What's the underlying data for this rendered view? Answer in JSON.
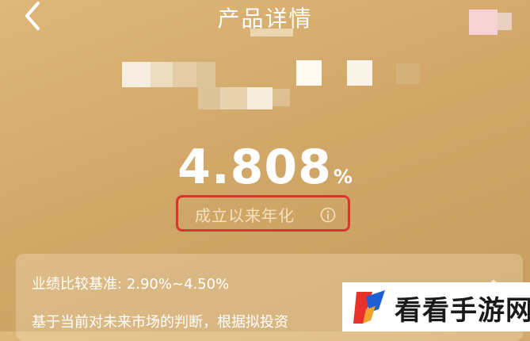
{
  "header": {
    "title": "产品详情"
  },
  "rate": {
    "value": "4.808",
    "unit": "%",
    "label": "成立以来年化"
  },
  "benchmark": {
    "line": "业绩比较基准: 2.90%~4.50%",
    "description": "基于当前对未来市场的判断，根据拟投资"
  },
  "watermark": {
    "text": "看看手游网"
  },
  "colors": {
    "background": "#d2a869",
    "highlight_border": "#d9362b",
    "text_primary": "#ffffff",
    "text_muted": "#f3e1c0"
  },
  "icons": {
    "back": "chevron-left-icon",
    "info": "info-icon",
    "expand": "chevron-up-icon"
  }
}
